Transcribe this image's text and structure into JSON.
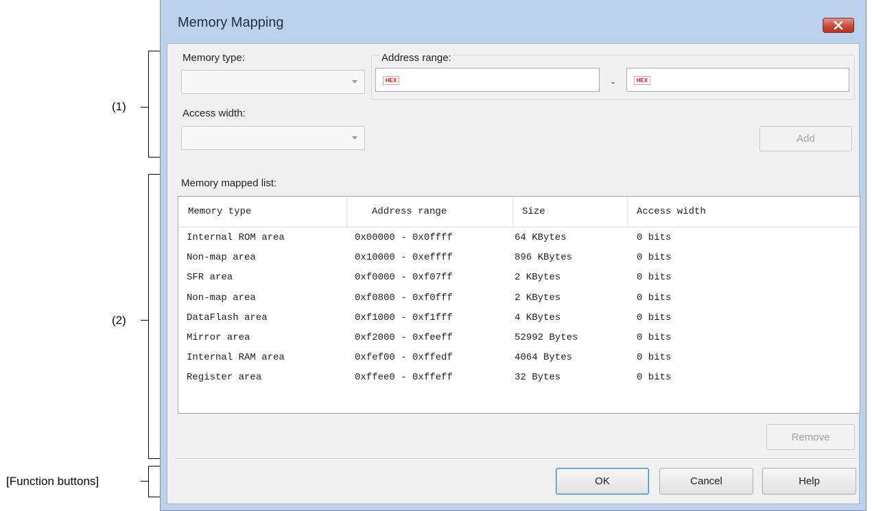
{
  "annotations": {
    "section1": "(1)",
    "section2": "(2)",
    "function_buttons": "[Function buttons]"
  },
  "window": {
    "title": "Memory Mapping",
    "close_icon": "close-icon"
  },
  "form": {
    "memory_type_label": "Memory type:",
    "memory_type_value": "",
    "access_width_label": "Access width:",
    "access_width_value": "",
    "address_range_label": "Address range:",
    "address_start_value": "",
    "address_separator": "-",
    "address_end_value": "",
    "hex_badge": "HEX",
    "add_label": "Add"
  },
  "list": {
    "label": "Memory mapped list:",
    "columns": [
      "Memory type",
      "Address range",
      "Size",
      "Access width"
    ],
    "rows": [
      {
        "memory_type": "Internal ROM area",
        "address_range": "0x00000 - 0x0ffff",
        "size": "64 KBytes",
        "access_width": "0 bits"
      },
      {
        "memory_type": "Non-map area",
        "address_range": "0x10000 - 0xeffff",
        "size": "896 KBytes",
        "access_width": "0 bits"
      },
      {
        "memory_type": "SFR area",
        "address_range": "0xf0000 - 0xf07ff",
        "size": "2 KBytes",
        "access_width": "0 bits"
      },
      {
        "memory_type": "Non-map area",
        "address_range": "0xf0800 - 0xf0fff",
        "size": "2 KBytes",
        "access_width": "0 bits"
      },
      {
        "memory_type": "DataFlash area",
        "address_range": "0xf1000 - 0xf1fff",
        "size": "4 KBytes",
        "access_width": "0 bits"
      },
      {
        "memory_type": "Mirror area",
        "address_range": "0xf2000 - 0xfeeff",
        "size": "52992 Bytes",
        "access_width": "0 bits"
      },
      {
        "memory_type": "Internal RAM area",
        "address_range": "0xfef00 - 0xffedf",
        "size": "4064 Bytes",
        "access_width": "0 bits"
      },
      {
        "memory_type": "Register area",
        "address_range": "0xffee0 - 0xffeff",
        "size": "32 Bytes",
        "access_width": "0 bits"
      }
    ],
    "remove_label": "Remove"
  },
  "buttons": {
    "ok": "OK",
    "cancel": "Cancel",
    "help": "Help"
  }
}
